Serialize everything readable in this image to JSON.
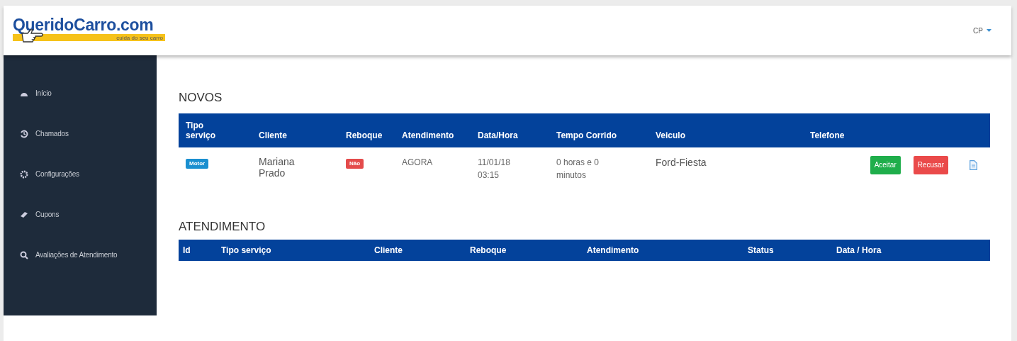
{
  "header": {
    "logo": {
      "title": "QueridoCarro.com",
      "tagline": "cuida do seu carro"
    },
    "user_menu": {
      "label": "CP"
    }
  },
  "sidebar": {
    "items": [
      {
        "label": "Início"
      },
      {
        "label": "Chamados"
      },
      {
        "label": "Configurações"
      },
      {
        "label": "Cupons"
      },
      {
        "label": "Avaliações de Atendimento"
      }
    ]
  },
  "novos": {
    "title": "NOVOS",
    "columns": [
      "Tipo serviço",
      "Cliente",
      "Reboque",
      "Atendimento",
      "Data/Hora",
      "Tempo Corrido",
      "Veiculo",
      "Telefone"
    ],
    "rows": [
      {
        "tipo_servico": "Motor",
        "cliente": "Mariana Prado",
        "reboque": "Não",
        "atendimento": "AGORA",
        "data_hora": "11/01/18 03:15",
        "tempo_corrido": "0 horas e 0 minutos",
        "veiculo": "Ford-Fiesta",
        "actions": [
          {
            "label": "Aceitar",
            "kind": "accept"
          },
          {
            "label": "Recusar",
            "kind": "refuse"
          }
        ]
      }
    ]
  },
  "atendimento": {
    "title": "ATENDIMENTO",
    "columns": [
      "Id",
      "Tipo serviço",
      "Cliente",
      "Reboque",
      "Atendimento",
      "Status",
      "Data / Hora"
    ]
  }
}
